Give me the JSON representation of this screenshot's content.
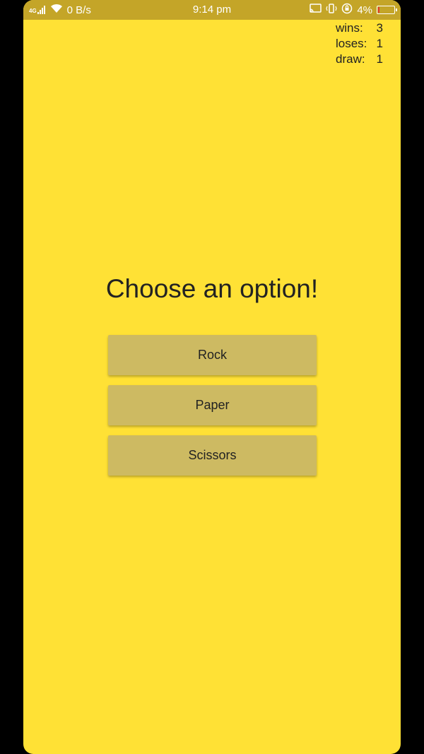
{
  "status_bar": {
    "network": "4G",
    "speed": "0 B/s",
    "time": "9:14 pm",
    "battery": "4%",
    "battery_level": 0.04,
    "background_color": "#C4A528",
    "icons": [
      "signal-icon",
      "wifi-icon",
      "cast-icon",
      "vibrate-icon",
      "rotation-lock-icon",
      "battery-icon"
    ]
  },
  "scoreboard": {
    "rows": [
      {
        "label": "wins:",
        "value": "3"
      },
      {
        "label": "loses:",
        "value": "1"
      },
      {
        "label": "draw:",
        "value": "1"
      }
    ]
  },
  "main": {
    "title": "Choose an option!",
    "options": [
      {
        "label": "Rock"
      },
      {
        "label": "Paper"
      },
      {
        "label": "Scissors"
      }
    ]
  },
  "colors": {
    "background": "#FFE135",
    "button": "#CDBA62",
    "text": "#222222",
    "battery_low": "#e53935"
  }
}
